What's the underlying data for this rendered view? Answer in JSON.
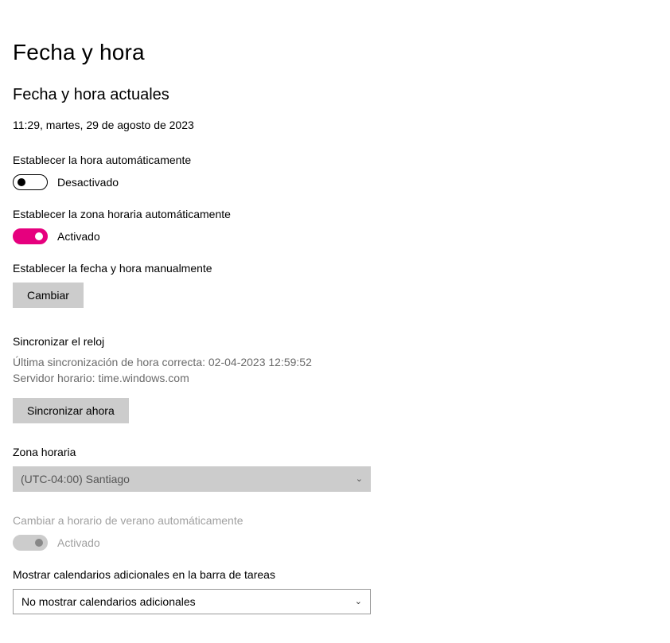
{
  "page": {
    "title": "Fecha y hora"
  },
  "current": {
    "heading": "Fecha y hora actuales",
    "datetime": "11:29, martes, 29 de agosto de 2023"
  },
  "autoTime": {
    "label": "Establecer la hora automáticamente",
    "state": "Desactivado"
  },
  "autoTz": {
    "label": "Establecer la zona horaria automáticamente",
    "state": "Activado"
  },
  "manual": {
    "label": "Establecer la fecha y hora manualmente",
    "button": "Cambiar"
  },
  "sync": {
    "heading": "Sincronizar el reloj",
    "lastSync": "Última sincronización de hora correcta: 02-04-2023 12:59:52",
    "server": "Servidor horario: time.windows.com",
    "button": "Sincronizar ahora"
  },
  "timezone": {
    "label": "Zona horaria",
    "value": "(UTC-04:00) Santiago"
  },
  "dst": {
    "label": "Cambiar a horario de verano automáticamente",
    "state": "Activado"
  },
  "calendars": {
    "label": "Mostrar calendarios adicionales en la barra de tareas",
    "value": "No mostrar calendarios adicionales"
  }
}
